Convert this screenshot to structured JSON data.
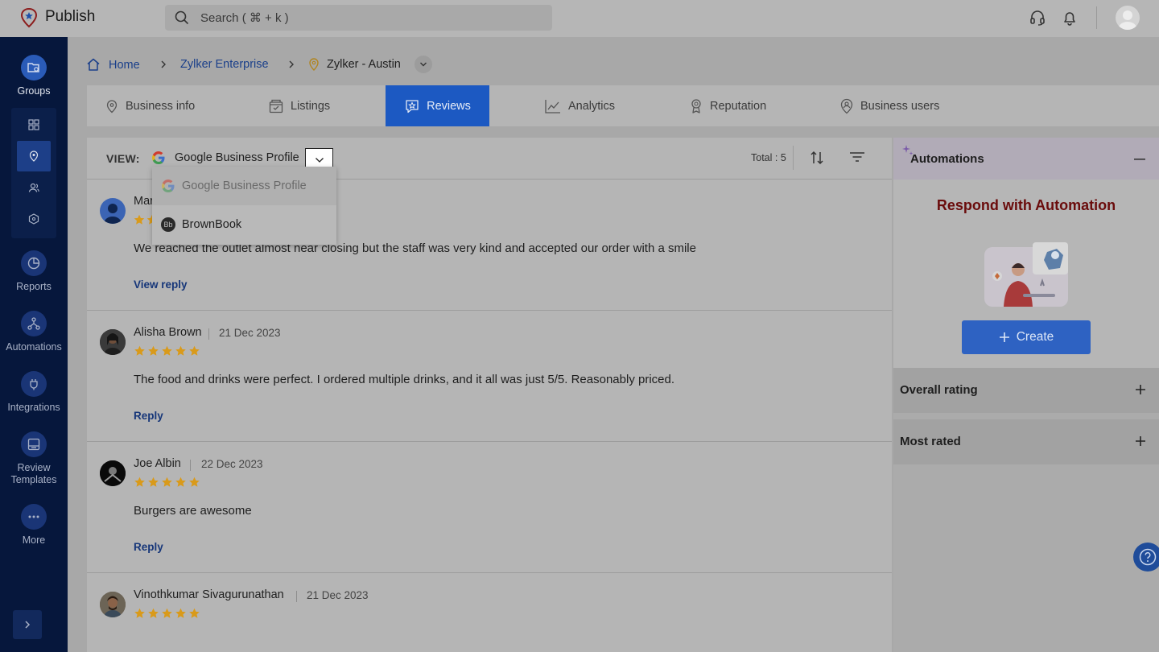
{
  "app": {
    "title": "Publish"
  },
  "search": {
    "placeholder": "Search ( ⌘ + k )"
  },
  "sidebar": {
    "items": [
      {
        "label": "Groups",
        "icon": "groups-icon"
      },
      {
        "label": "Reports",
        "icon": "reports-icon"
      },
      {
        "label": "Automations",
        "icon": "automations-icon"
      },
      {
        "label": "Integrations",
        "icon": "integrations-icon"
      },
      {
        "label": "Review Templates",
        "icon": "review-templates-icon"
      },
      {
        "label": "More",
        "icon": "more-icon"
      }
    ]
  },
  "breadcrumb": {
    "home": "Home",
    "org": "Zylker Enterprise",
    "location": "Zylker - Austin"
  },
  "tabs": [
    {
      "label": "Business info",
      "icon": "location-pin-icon"
    },
    {
      "label": "Listings",
      "icon": "listings-icon"
    },
    {
      "label": "Reviews",
      "icon": "reviews-icon",
      "active": true
    },
    {
      "label": "Analytics",
      "icon": "analytics-icon"
    },
    {
      "label": "Reputation",
      "icon": "reputation-icon"
    },
    {
      "label": "Business users",
      "icon": "business-users-icon"
    }
  ],
  "reviews_panel": {
    "view_label": "VIEW:",
    "view_value": "Google Business Profile",
    "total": "Total : 5",
    "dropdown_options": [
      "Google Business Profile",
      "BrownBook"
    ],
    "reviews": [
      {
        "name": "Mar",
        "date": "",
        "rating": 5,
        "text": "We reached the outlet almost near closing but the staff was very kind and accepted our order with a smile",
        "action": "View reply"
      },
      {
        "name": "Alisha Brown",
        "date": "21 Dec 2023",
        "rating": 5,
        "text": "The food and drinks were perfect. I ordered multiple drinks, and it all was just 5/5. Reasonably priced.",
        "action": "Reply"
      },
      {
        "name": "Joe Albin",
        "date": "22 Dec 2023",
        "rating": 5,
        "text": "Burgers are awesome",
        "action": "Reply"
      },
      {
        "name": "Vinothkumar Sivagurunathan",
        "date": "21 Dec 2023",
        "rating": 5,
        "text": "",
        "action": ""
      }
    ]
  },
  "right_panel": {
    "automations_title": "Automations",
    "cta": "Respond with Automation",
    "create_label": "Create",
    "overall_rating": "Overall rating",
    "most_rated": "Most rated"
  },
  "colors": {
    "accent": "#1c59c2",
    "sidebar": "#06173c",
    "star": "#d99a1a",
    "cta": "#6a0c0c"
  }
}
